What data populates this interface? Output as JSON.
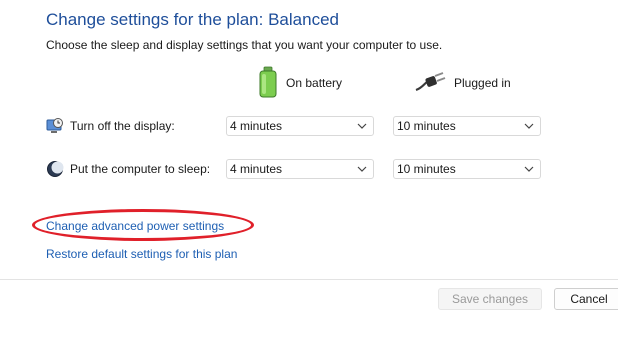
{
  "header": {
    "title": "Change settings for the plan: Balanced",
    "subtitle": "Choose the sleep and display settings that you want your computer to use."
  },
  "columns": {
    "battery": {
      "label": "On battery",
      "icon": "battery-icon"
    },
    "plugged": {
      "label": "Plugged in",
      "icon": "power-plug-icon"
    }
  },
  "rows": {
    "display": {
      "label": "Turn off the display:",
      "icon": "monitor-clock-icon",
      "battery_value": "4 minutes",
      "plugged_value": "10 minutes"
    },
    "sleep": {
      "label": "Put the computer to sleep:",
      "icon": "moon-sleep-icon",
      "battery_value": "4 minutes",
      "plugged_value": "10 minutes"
    }
  },
  "links": {
    "advanced": "Change advanced power settings",
    "restore": "Restore default settings for this plan"
  },
  "buttons": {
    "save": "Save changes",
    "cancel": "Cancel"
  },
  "colors": {
    "title": "#1e4e9a",
    "link": "#1e5fb3",
    "annotation": "#e0202a"
  }
}
